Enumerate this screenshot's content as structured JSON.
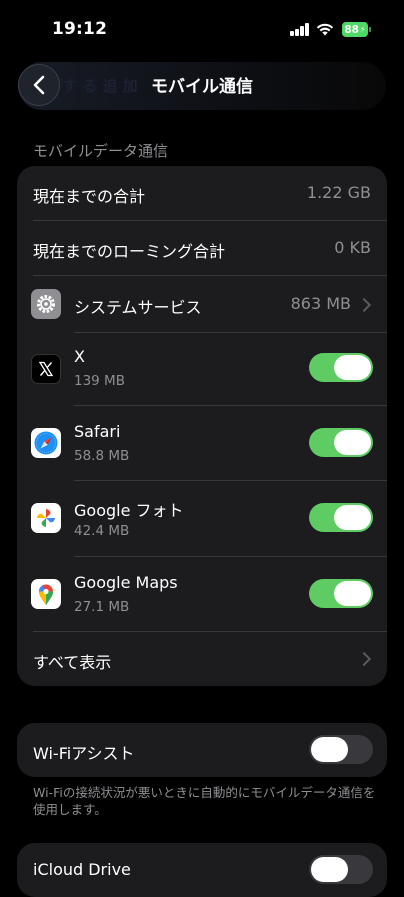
{
  "status": {
    "time": "19:12",
    "battery": "88"
  },
  "nav": {
    "back_hint": "す る 追 加",
    "title": "モバイル通信"
  },
  "section": {
    "header": "モバイルデータ通信"
  },
  "usage": {
    "total_label": "現在までの合計",
    "total_value": "1.22 GB",
    "roaming_label": "現在までのローミング合計",
    "roaming_value": "0 KB",
    "system_label": "システムサービス",
    "system_value": "863 MB"
  },
  "apps": [
    {
      "name": "X",
      "usage": "139 MB",
      "enabled": true,
      "icon": "x-logo-icon"
    },
    {
      "name": "Safari",
      "usage": "58.8 MB",
      "enabled": true,
      "icon": "safari-compass-icon"
    },
    {
      "name": "Google フォト",
      "usage": "42.4 MB",
      "enabled": true,
      "icon": "google-photos-pinwheel-icon"
    },
    {
      "name": "Google Maps",
      "usage": "27.1 MB",
      "enabled": true,
      "icon": "google-maps-pin-icon"
    }
  ],
  "show_all": {
    "label": "すべて表示"
  },
  "wifi_assist": {
    "label": "Wi-Fiアシスト",
    "enabled": false,
    "footnote": "Wi-Fiの接続状況が悪いときに自動的にモバイルデータ通信を使用します。"
  },
  "icloud_drive": {
    "label": "iCloud Drive",
    "enabled": false
  },
  "colors": {
    "toggle_on": "#5fcb63",
    "toggle_off": "#39393d",
    "card": "#1c1c1e",
    "battery": "#4cd964"
  }
}
